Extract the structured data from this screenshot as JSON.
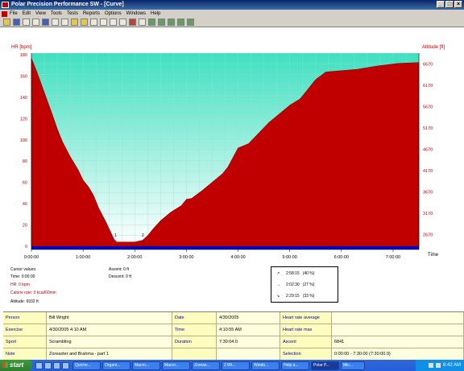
{
  "window": {
    "title": "Polar Precision Performance SW - [Curve]",
    "controls": [
      "_",
      "□",
      "×"
    ]
  },
  "menu": [
    "File",
    "Edit",
    "View",
    "Tools",
    "Tests",
    "Reports",
    "Options",
    "Windows",
    "Help"
  ],
  "colors": {
    "accent_red": "#c00000",
    "axis_blue": "#0000c0",
    "sky_top": "#40e0c0",
    "sky_bottom": "#ffffff"
  },
  "chart_data": {
    "type": "area",
    "left_axis": {
      "label": "HR [bpm]",
      "ticks": [
        "180",
        "160",
        "140",
        "120",
        "100",
        "80",
        "60",
        "40",
        "20",
        "0"
      ]
    },
    "right_axis": {
      "label": "Altitude [ft]",
      "ticks": [
        "6670",
        "6170",
        "5670",
        "5170",
        "4670",
        "4170",
        "3670",
        "3170",
        "2670"
      ]
    },
    "x_axis": {
      "label": "Time",
      "ticks": [
        "0:00:00",
        "1:00:00",
        "2:00:00",
        "3:00:00",
        "4:00:00",
        "5:00:00",
        "6:00:00",
        "7:00:00"
      ]
    },
    "series": [
      {
        "name": "Altitude",
        "x_hours": [
          0,
          0.1,
          0.25,
          0.4,
          0.5,
          0.6,
          0.75,
          0.9,
          1.0,
          1.1,
          1.2,
          1.3,
          1.45,
          1.6,
          1.65,
          1.75,
          2.0,
          2.15,
          2.25,
          2.35,
          2.5,
          2.7,
          2.9,
          3.0,
          3.1,
          3.3,
          3.5,
          3.7,
          3.8,
          4.0,
          4.2,
          4.4,
          4.6,
          4.8,
          5.0,
          5.2,
          5.3,
          5.5,
          5.7,
          5.9,
          6.1,
          6.3,
          6.5,
          6.7,
          6.9,
          7.1,
          7.3,
          7.5
        ],
        "y_ft": [
          6800,
          6500,
          6000,
          5500,
          5150,
          4850,
          4500,
          4200,
          3950,
          3800,
          3600,
          3300,
          2950,
          2560,
          2500,
          2500,
          2500,
          2540,
          2650,
          2800,
          3000,
          3200,
          3350,
          3500,
          3520,
          3700,
          3900,
          4100,
          4250,
          4700,
          4800,
          5050,
          5300,
          5500,
          5700,
          5850,
          6000,
          6300,
          6480,
          6500,
          6520,
          6540,
          6580,
          6620,
          6650,
          6680,
          6690,
          6700
        ]
      }
    ],
    "markers": [
      "1",
      "2"
    ]
  },
  "info": {
    "cursor_values": "Cursor values:",
    "time": "Time: 0:00:00",
    "hr": "HR: 0 bpm",
    "calorie_rate": "Calorie rate: 0 kcal/60min",
    "altitude": "Altitude: 6932 ft",
    "ascent": "Ascent: 0 ft",
    "descent": "Descent: 0 ft"
  },
  "zones": [
    {
      "arrow": "↗",
      "time": "2:58:15",
      "pct": "(40 %)"
    },
    {
      "arrow": "→",
      "time": "2:02:30",
      "pct": "(27 %)"
    },
    {
      "arrow": "↘",
      "time": "2:29:15",
      "pct": "(33 %)"
    }
  ],
  "table": {
    "rows": [
      [
        {
          "l": "Person"
        },
        {
          "v": "Bill Wright"
        },
        {
          "l": "Date"
        },
        {
          "v": "4/30/2005"
        },
        {
          "l": "Heart rate average"
        },
        {
          "v": ""
        }
      ],
      [
        {
          "l": "Exercise"
        },
        {
          "v": "4/30/2005 4:10 AM"
        },
        {
          "l": "Time"
        },
        {
          "v": "4:10:55 AM"
        },
        {
          "l": "Heart rate max"
        },
        {
          "v": ""
        }
      ],
      [
        {
          "l": "Sport"
        },
        {
          "v": "Scrambling"
        },
        {
          "l": "Duration"
        },
        {
          "v": "7:30:04.0"
        },
        {
          "l": "Ascent"
        },
        {
          "v": "6841"
        }
      ],
      [
        {
          "l": "Note"
        },
        {
          "v": "Zoreaster and Brahma - part 1"
        },
        {
          "l": ""
        },
        {
          "v": ""
        },
        {
          "l": "Selection"
        },
        {
          "v": "0:00:00 - 7:30:00 (7:30:00.0)"
        }
      ]
    ]
  },
  "taskbar": {
    "start": "start",
    "tasks": [
      "Quiche...",
      "Organi...",
      "Macro...",
      "Macro...",
      "Zoreas...",
      "2 Wi...",
      "Windo...",
      "Help a...",
      "Polar P...",
      "Mic..."
    ],
    "clock": "8:42 AM"
  }
}
